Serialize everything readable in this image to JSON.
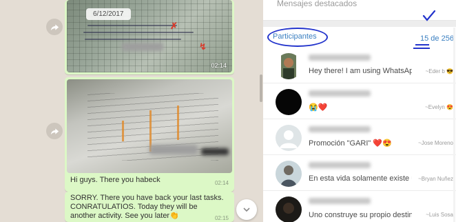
{
  "chat": {
    "image_message_1": {
      "date_label": "6/12/2017",
      "time": "02:14"
    },
    "image_message_2": {
      "caption": "Hi guys. There you habeck",
      "time": "02:14"
    },
    "text_message": {
      "text": "SORRY. There you have back your last tasks. CONRATULATIOS. Today they will be another activity.  See you later👏",
      "time": "02:15"
    }
  },
  "info_panel": {
    "starred_section_label": "Mensajes destacados",
    "participants": {
      "title": "Participantes",
      "count": "15 de 256",
      "members": [
        {
          "status": "Hey there! I am using WhatsApp.",
          "push_name": "~Eder b 😎",
          "avatar": "photo-man-icon"
        },
        {
          "status": "😭❤️",
          "push_name": "~Evelyn 😍",
          "avatar": "dark-avatar-icon"
        },
        {
          "status": "Promoción \"GARI\" ❤️😍",
          "push_name": "~Jose Moreno",
          "avatar": "default-avatar-icon"
        },
        {
          "status": "En esta vida solamente existe un...",
          "push_name": "~Bryan Nuñez",
          "avatar": "photo-avatar-icon"
        },
        {
          "status": "Uno construye su propio destino 😊",
          "push_name": "~Luis Sosa",
          "avatar": "dark-photo-avatar-icon"
        }
      ]
    }
  },
  "colors": {
    "bubble_outgoing": "#dcf8c6",
    "chat_background": "#e4ddd4",
    "link_blue": "#3a7fc1",
    "annotation_ink": "#2233cc"
  }
}
